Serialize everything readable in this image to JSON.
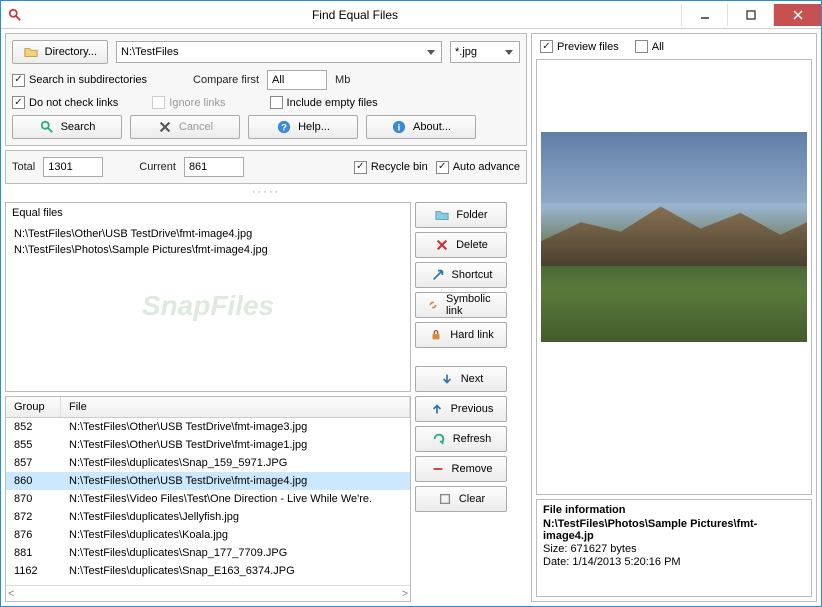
{
  "titlebar": {
    "title": "Find Equal Files"
  },
  "toolbar": {
    "directory_btn": "Directory...",
    "directory_value": "N:\\TestFiles",
    "filter_value": "*.jpg",
    "search_subdirs": "Search in subdirectories",
    "compare_first": "Compare first",
    "compare_value": "All",
    "mb": "Mb",
    "dont_check_links": "Do not check links",
    "ignore_links": "Ignore links",
    "include_empty": "Include empty files",
    "search_btn": "Search",
    "cancel_btn": "Cancel",
    "help_btn": "Help...",
    "about_btn": "About..."
  },
  "status": {
    "total_label": "Total",
    "total_value": "1301",
    "current_label": "Current",
    "current_value": "861",
    "recycle_bin": "Recycle bin",
    "auto_advance": "Auto advance"
  },
  "equal": {
    "header": "Equal files",
    "items": [
      "N:\\TestFiles\\Other\\USB TestDrive\\fmt-image4.jpg",
      "N:\\TestFiles\\Photos\\Sample Pictures\\fmt-image4.jpg"
    ]
  },
  "actions": {
    "folder": "Folder",
    "delete": "Delete",
    "shortcut": "Shortcut",
    "symlink": "Symbolic link",
    "hardlink": "Hard link",
    "next": "Next",
    "previous": "Previous",
    "refresh": "Refresh",
    "remove": "Remove",
    "clear": "Clear"
  },
  "table": {
    "col_group": "Group",
    "col_file": "File",
    "rows": [
      {
        "group": "852",
        "file": "N:\\TestFiles\\Other\\USB TestDrive\\fmt-image3.jpg",
        "selected": false
      },
      {
        "group": "855",
        "file": "N:\\TestFiles\\Other\\USB TestDrive\\fmt-image1.jpg",
        "selected": false
      },
      {
        "group": "857",
        "file": "N:\\TestFiles\\duplicates\\Snap_159_5971.JPG",
        "selected": false
      },
      {
        "group": "860",
        "file": "N:\\TestFiles\\Other\\USB TestDrive\\fmt-image4.jpg",
        "selected": true
      },
      {
        "group": "870",
        "file": "N:\\TestFiles\\Video Files\\Test\\One Direction - Live While We're.",
        "selected": false
      },
      {
        "group": "872",
        "file": "N:\\TestFiles\\duplicates\\Jellyfish.jpg",
        "selected": false
      },
      {
        "group": "876",
        "file": "N:\\TestFiles\\duplicates\\Koala.jpg",
        "selected": false
      },
      {
        "group": "881",
        "file": "N:\\TestFiles\\duplicates\\Snap_177_7709.JPG",
        "selected": false
      },
      {
        "group": "1162",
        "file": "N:\\TestFiles\\duplicates\\Snap_E163_6374.JPG",
        "selected": false
      }
    ]
  },
  "preview": {
    "preview_files": "Preview files",
    "all": "All"
  },
  "fileinfo": {
    "title": "File information",
    "path": "N:\\TestFiles\\Photos\\Sample Pictures\\fmt-image4.jp",
    "size": "Size: 671627 bytes",
    "date": "Date: 1/14/2013 5:20:16 PM"
  }
}
